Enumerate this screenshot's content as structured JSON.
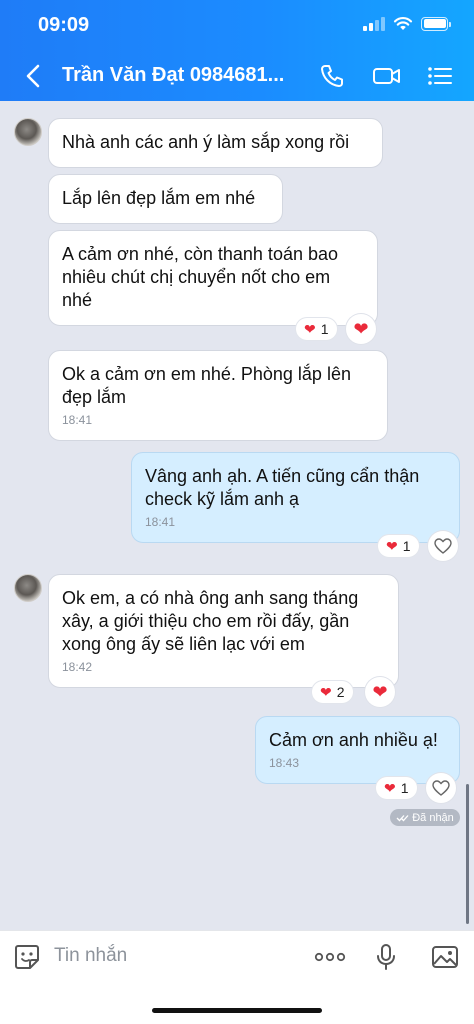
{
  "status_bar": {
    "time": "09:09"
  },
  "header": {
    "title": "Trần Văn Đạt 0984681..."
  },
  "messages": [
    {
      "text": "Nhà anh các anh ý làm sắp xong rồi"
    },
    {
      "text": "Lắp lên đẹp lắm em nhé"
    },
    {
      "text": "A cảm ơn nhé, còn thanh toán bao nhiêu chút chị chuyển nốt cho em nhé",
      "reaction_count": "1"
    },
    {
      "text": "Ok a cảm ơn em nhé. Phòng lắp lên đẹp lắm",
      "time": "18:41"
    },
    {
      "text": "Vâng anh ạh. A tiến cũng cẩn thận check kỹ lắm anh ạ",
      "time": "18:41",
      "reaction_count": "1"
    },
    {
      "text": "Ok em, a có nhà ông anh sang tháng xây, a giới thiệu cho em rồi đấy, gần xong ông ấy sẽ liên lạc với em",
      "time": "18:42",
      "reaction_count": "2"
    },
    {
      "text": "Cảm ơn anh nhiều ạ!",
      "time": "18:43",
      "reaction_count": "1"
    }
  ],
  "received_label": "Đã nhận",
  "composer": {
    "placeholder": "Tin nhắn"
  },
  "colors": {
    "header_start": "#1f7cf7",
    "header_end": "#14a6ff",
    "my_bubble": "#d5eeff",
    "heart": "#ea2a3a"
  }
}
